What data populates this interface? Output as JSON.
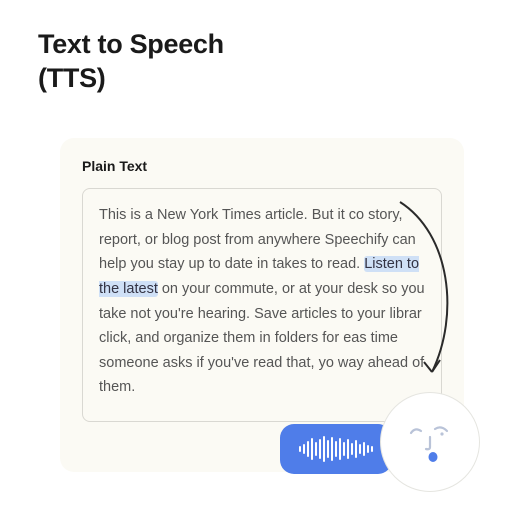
{
  "heading": {
    "line1": "Text to Speech",
    "line2": "(TTS)"
  },
  "card": {
    "label": "Plain Text",
    "body_before": "This is a New York Times article. But it co story, report, or blog post from anywhere Speechify can help you stay up to date in takes to read. ",
    "body_highlight": "Listen to the latest",
    "body_after": " on your commute, or at your desk so you take not you're hearing. Save articles to your librar click, and organize them in folders for eas time someone asks if you've read that, yo way ahead of them."
  },
  "icons": {
    "speak": "waveform-icon",
    "face": "speaking-face-icon",
    "arrow": "arrow-icon"
  },
  "colors": {
    "accent": "#4f7de9",
    "card_bg": "#fbfaf4",
    "highlight": "#cfe0f6"
  }
}
